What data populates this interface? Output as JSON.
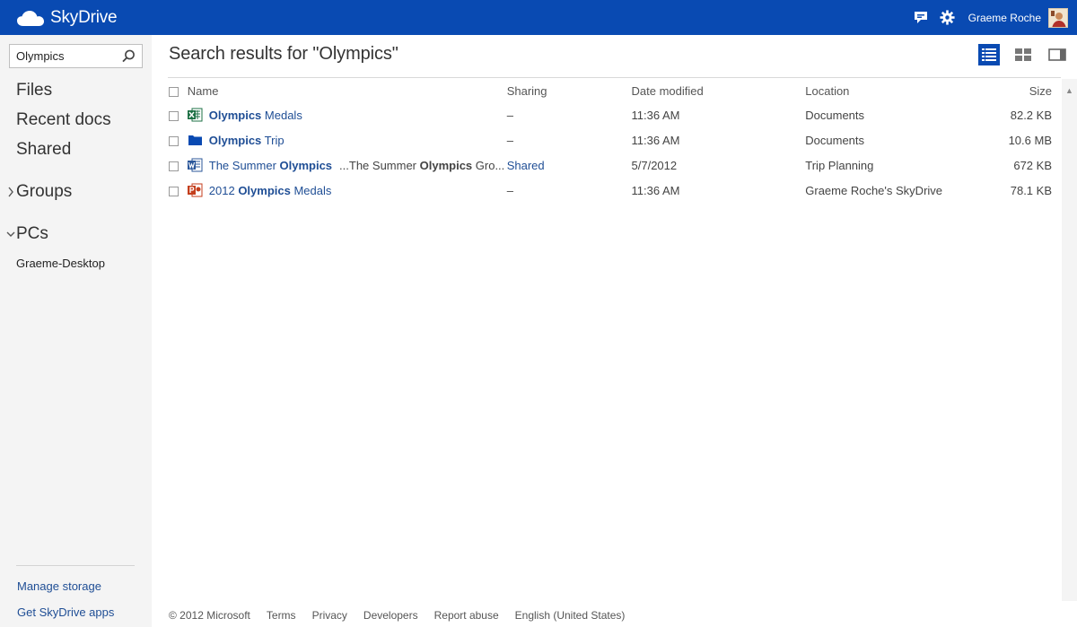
{
  "topbar": {
    "brand": "SkyDrive",
    "user_name": "Graeme Roche",
    "icons": [
      "feedback-icon",
      "gear-icon"
    ]
  },
  "sidebar": {
    "search_value": "Olympics",
    "nav": {
      "files": "Files",
      "recent": "Recent docs",
      "shared": "Shared",
      "groups": "Groups",
      "pcs": "PCs",
      "pc_item": "Graeme-Desktop"
    },
    "manage_storage": "Manage storage",
    "get_apps": "Get SkyDrive apps"
  },
  "main": {
    "title": "Search results for \"Olympics\"",
    "columns": {
      "name": "Name",
      "sharing": "Sharing",
      "date": "Date modified",
      "location": "Location",
      "size": "Size"
    },
    "rows": [
      {
        "type": "excel",
        "name_bold": "Olympics",
        "name_rest": " Medals",
        "sharing": "–",
        "date": "11:36 AM",
        "location": "Documents",
        "size": "82.2 KB"
      },
      {
        "type": "folder",
        "name_bold": "Olympics",
        "name_rest": " Trip",
        "sharing": "–",
        "date": "11:36 AM",
        "location": "Documents",
        "size": "10.6 MB"
      },
      {
        "type": "word",
        "name_pre": "The Summer ",
        "name_bold": "Olympics",
        "snippet_pre": "...The Summer ",
        "snippet_bold": "Olympics",
        "snippet_post": " Gro...",
        "sharing": "Shared",
        "date": "5/7/2012",
        "location": "Trip Planning",
        "size": "672 KB"
      },
      {
        "type": "powerpoint",
        "name_pre": "2012 ",
        "name_bold": "Olympics",
        "name_rest": " Medals",
        "sharing": "–",
        "date": "11:36 AM",
        "location": "Graeme Roche's SkyDrive",
        "size": "78.1 KB"
      }
    ]
  },
  "footer": {
    "copyright": "© 2012 Microsoft",
    "terms": "Terms",
    "privacy": "Privacy",
    "developers": "Developers",
    "report": "Report abuse",
    "language": "English (United States)"
  },
  "colors": {
    "topbar": "#094ab2",
    "link": "#1f4e95",
    "sidebar_bg": "#f4f4f4",
    "excel": "#1e7145",
    "word": "#2b579a",
    "powerpoint": "#c43e1c"
  }
}
